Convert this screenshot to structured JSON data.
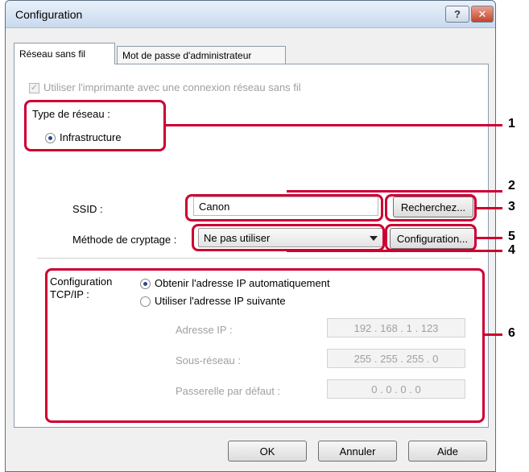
{
  "window": {
    "title": "Configuration",
    "help_label": "?",
    "close_label": "✕"
  },
  "tabs": [
    {
      "label": "Réseau sans fil"
    },
    {
      "label": "Mot de passe d'administrateur"
    }
  ],
  "wireless": {
    "use_printer_label": "Utiliser l'imprimante avec une connexion réseau sans fil",
    "use_printer_checked": true,
    "network_type_label": "Type de réseau :",
    "infrastructure_label": "Infrastructure",
    "ssid_label": "SSID :",
    "ssid_value": "Canon",
    "search_button": "Recherchez...",
    "encryption_label": "Méthode de cryptage :",
    "encryption_value": "Ne pas utiliser",
    "config_button": "Configuration..."
  },
  "tcpip": {
    "section_label_line1": "Configuration",
    "section_label_line2": "TCP/IP :",
    "auto_ip_label": "Obtenir l'adresse IP automatiquement",
    "manual_ip_label": "Utiliser l'adresse IP suivante",
    "ip_label": "Adresse IP :",
    "ip_value": "192 . 168 .   1  . 123",
    "subnet_label": "Sous-réseau :",
    "subnet_value": "255 . 255 . 255 .  0",
    "gateway_label": "Passerelle par défaut :",
    "gateway_value": "0  .  0  .  0  .  0"
  },
  "buttons": {
    "ok": "OK",
    "cancel": "Annuler",
    "help": "Aide"
  },
  "callouts": [
    "1",
    "2",
    "3",
    "4",
    "5",
    "6"
  ],
  "colors": {
    "callout": "#cc0033",
    "titlebar": "#c9daee"
  }
}
